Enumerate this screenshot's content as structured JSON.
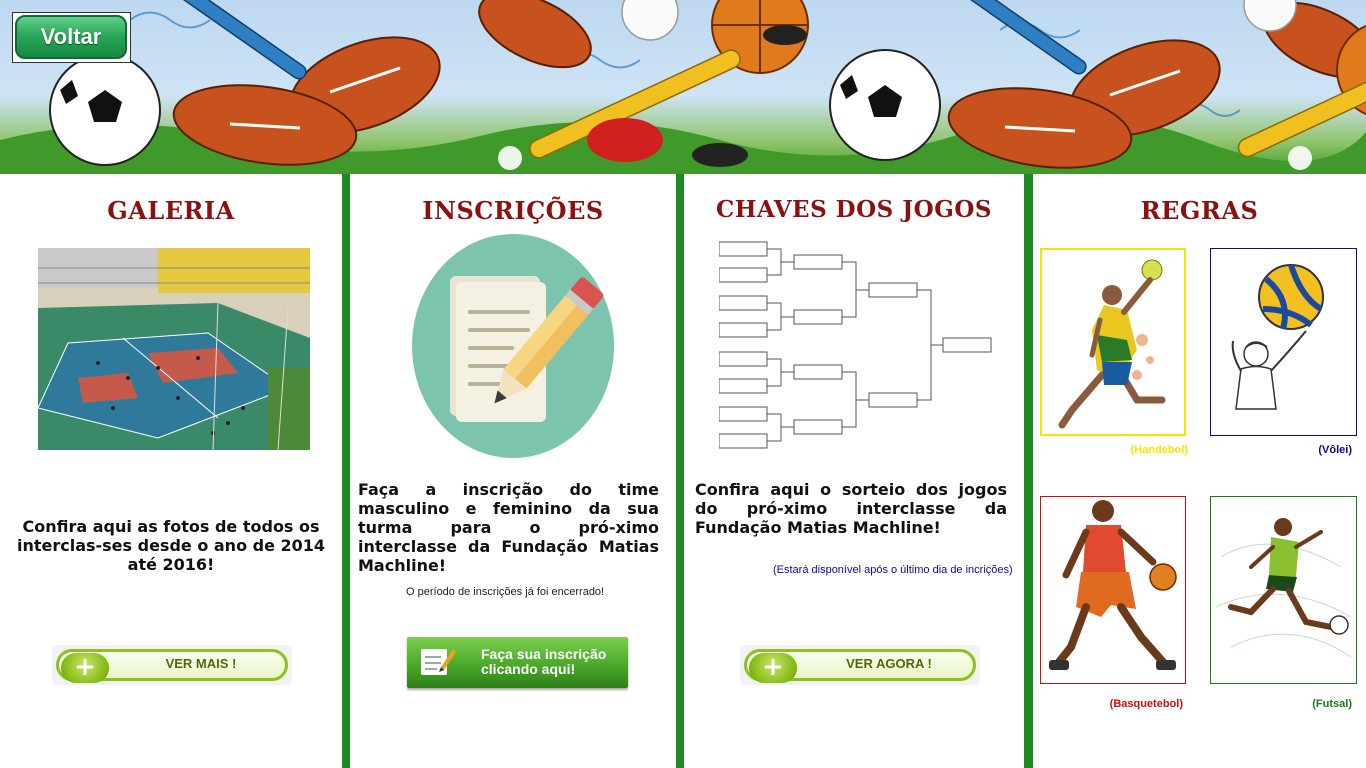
{
  "header": {
    "back_label": "Voltar"
  },
  "gallery": {
    "title": "GALERIA",
    "description": "Confira aqui as fotos de todos os interclas-ses desde o ano de 2014 até 2016!",
    "button_label": "VER MAIS !"
  },
  "registration": {
    "title": "INSCRIÇÕES",
    "description": "Faça a inscrição do time masculino e feminino da sua turma para o pró-ximo interclasse da Fundação Matias Machline!",
    "note": "O período de inscrições já foi encerrado!",
    "button_line1_prefix": "Faça sua ",
    "button_line1_bold": "inscrição",
    "button_line2": "clicando aqui!"
  },
  "brackets": {
    "title": "CHAVES DOS JOGOS",
    "description": "Confira aqui o sorteio dos jogos do pró-ximo interclasse da Fundação Matias Machline!",
    "availability_note": "(Estará disponível após o último dia de incrições)",
    "button_label": "VER AGORA !"
  },
  "rules": {
    "title": "REGRAS",
    "sports": [
      {
        "label": "(Handebol)",
        "color": "#f2e600"
      },
      {
        "label": "(Vôlei)",
        "color": "#0a0a8c"
      },
      {
        "label": "(Basquetebol)",
        "color": "#c81010"
      },
      {
        "label": "(Futsal)",
        "color": "#1a7a1a"
      }
    ]
  },
  "colors": {
    "title": "#8b1010",
    "divider": "#1e8a26",
    "accent_green": "#8cc21a"
  }
}
